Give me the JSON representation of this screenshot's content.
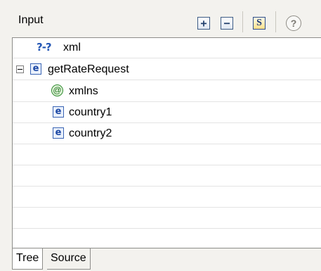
{
  "header": {
    "title": "Input",
    "expand_glyph": "+",
    "collapse_glyph": "−",
    "schema_glyph": "S",
    "help_glyph": "?"
  },
  "tree": {
    "rows": [
      {
        "icon": "question-icon",
        "icon_text": "?-?",
        "label": "xml"
      },
      {
        "icon": "element-icon",
        "icon_text": "e",
        "label": "getRateRequest",
        "expanded": true
      },
      {
        "icon": "attribute-icon",
        "icon_text": "@",
        "label": "xmlns"
      },
      {
        "icon": "element-icon",
        "icon_text": "e",
        "label": "country1"
      },
      {
        "icon": "element-icon",
        "icon_text": "e",
        "label": "country2"
      }
    ]
  },
  "tabs": [
    {
      "label": "Tree",
      "active": true
    },
    {
      "label": "Source",
      "active": false
    }
  ],
  "colors": {
    "background": "#f3f2ee",
    "panel": "#ffffff",
    "element_icon": "#1a46a4",
    "attribute_icon": "#227322",
    "question_icon": "#2356b4"
  }
}
